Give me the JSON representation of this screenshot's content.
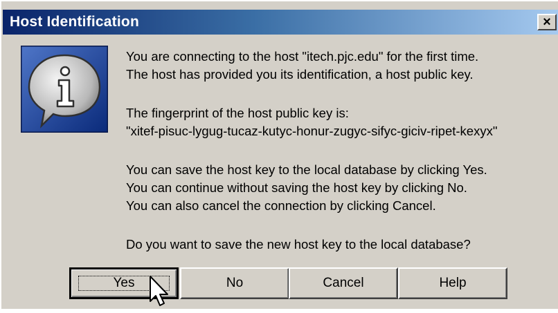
{
  "dialog": {
    "title": "Host Identification",
    "close_glyph": "×",
    "icon": "information-speech-bubble-icon",
    "messages": {
      "line1": "You are connecting to the host \"itech.pjc.edu\" for the first time.",
      "line2": "The host has provided you its identification, a host public key.",
      "line3": "The fingerprint of the host public key is:",
      "line4": "\"xitef-pisuc-lygug-tucaz-kutyc-honur-zugyc-sifyc-giciv-ripet-kexyx\"",
      "line5": "You can save the host key to the local database by clicking Yes.",
      "line6": "You can continue without saving the host key by clicking No.",
      "line7": "You can also cancel the connection by clicking Cancel.",
      "line8": "Do you want to save the new host key to the local database?"
    },
    "buttons": {
      "yes": "Yes",
      "no": "No",
      "cancel": "Cancel",
      "help": "Help"
    },
    "colors": {
      "titlebar_start": "#0a246a",
      "titlebar_end": "#a6caf0",
      "face": "#d4d0c8"
    }
  }
}
